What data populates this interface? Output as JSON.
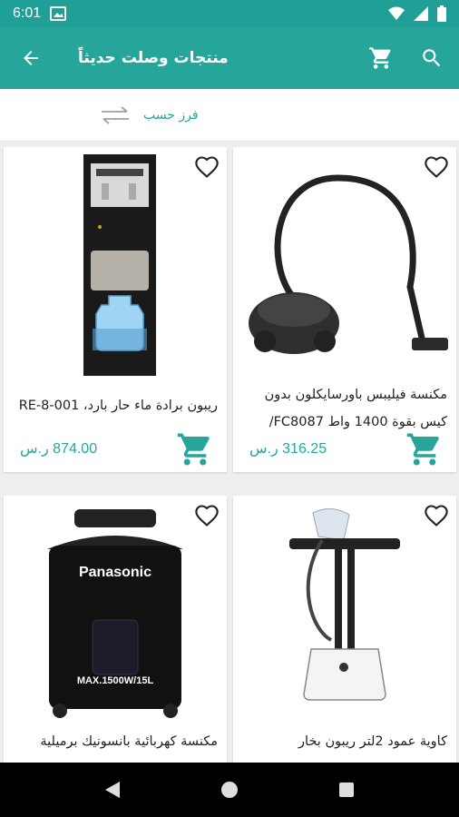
{
  "status_bar": {
    "time": "6:01"
  },
  "app_bar": {
    "title": "منتجات وصلت حديثاً"
  },
  "sort": {
    "label": "فرز حسب"
  },
  "products": [
    {
      "name": "ريبون برادة ماء حار بارد، RE-8-001",
      "price": "874.00 ر.س"
    },
    {
      "name": "مكنسة فيليبس باورسايكلون بدون كيس بقوة 1400 واط FC8087/",
      "price": "316.25 ر.س"
    },
    {
      "name": "مكنسة كهربائية بانسونيك برميلية",
      "price": ""
    },
    {
      "name": "كاوية عمود 2لتر ريبون بخار",
      "price": ""
    }
  ],
  "product_images": {
    "brand_text": "Panasonic",
    "power_text": "MAX.1500W/15L"
  },
  "colors": {
    "accent": "#26a69a",
    "status_bar": "#1f9f95"
  }
}
